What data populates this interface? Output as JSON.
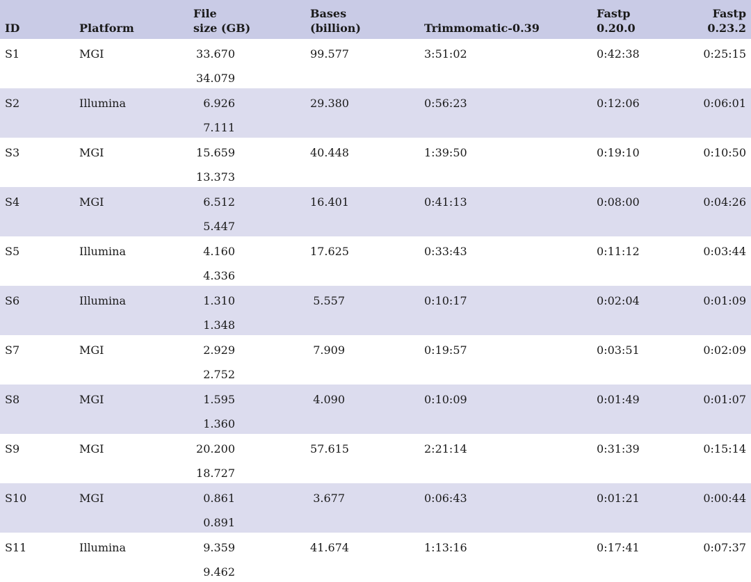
{
  "headers": {
    "id": "ID",
    "platform": "Platform",
    "file_size": [
      "File",
      "size (GB)"
    ],
    "bases": [
      "Bases",
      "(billion)"
    ],
    "trimmomatic": "Trimmomatic-0.39",
    "fastp_20": [
      "Fastp",
      "0.20.0"
    ],
    "fastp_23": [
      "Fastp",
      "0.23.2"
    ]
  },
  "rows": [
    {
      "id": "S1",
      "platform": "MGI",
      "size1": "33.670",
      "size2": "34.079",
      "bases": "99.577",
      "trim": "3:51:02",
      "f20": "0:42:38",
      "f23": "0:25:15"
    },
    {
      "id": "S2",
      "platform": "Illumina",
      "size1": "6.926",
      "size2": "7.111",
      "bases": "29.380",
      "trim": "0:56:23",
      "f20": "0:12:06",
      "f23": "0:06:01"
    },
    {
      "id": "S3",
      "platform": "MGI",
      "size1": "15.659",
      "size2": "13.373",
      "bases": "40.448",
      "trim": "1:39:50",
      "f20": "0:19:10",
      "f23": "0:10:50"
    },
    {
      "id": "S4",
      "platform": "MGI",
      "size1": "6.512",
      "size2": "5.447",
      "bases": "16.401",
      "trim": "0:41:13",
      "f20": "0:08:00",
      "f23": "0:04:26"
    },
    {
      "id": "S5",
      "platform": "Illumina",
      "size1": "4.160",
      "size2": "4.336",
      "bases": "17.625",
      "trim": "0:33:43",
      "f20": "0:11:12",
      "f23": "0:03:44"
    },
    {
      "id": "S6",
      "platform": "Illumina",
      "size1": "1.310",
      "size2": "1.348",
      "bases": "5.557",
      "trim": "0:10:17",
      "f20": "0:02:04",
      "f23": "0:01:09"
    },
    {
      "id": "S7",
      "platform": "MGI",
      "size1": "2.929",
      "size2": "2.752",
      "bases": "7.909",
      "trim": "0:19:57",
      "f20": "0:03:51",
      "f23": "0:02:09"
    },
    {
      "id": "S8",
      "platform": "MGI",
      "size1": "1.595",
      "size2": "1.360",
      "bases": "4.090",
      "trim": "0:10:09",
      "f20": "0:01:49",
      "f23": "0:01:07"
    },
    {
      "id": "S9",
      "platform": "MGI",
      "size1": "20.200",
      "size2": "18.727",
      "bases": "57.615",
      "trim": "2:21:14",
      "f20": "0:31:39",
      "f23": "0:15:14"
    },
    {
      "id": "S10",
      "platform": "MGI",
      "size1": "0.861",
      "size2": "0.891",
      "bases": "3.677",
      "trim": "0:06:43",
      "f20": "0:01:21",
      "f23": "0:00:44"
    },
    {
      "id": "S11",
      "platform": "Illumina",
      "size1": "9.359",
      "size2": "9.462",
      "bases": "41.674",
      "trim": "1:13:16",
      "f20": "0:17:41",
      "f23": "0:07:37"
    }
  ],
  "colors": {
    "header_bg": "#c9cbe6",
    "stripe_bg": "#dcdcee"
  }
}
